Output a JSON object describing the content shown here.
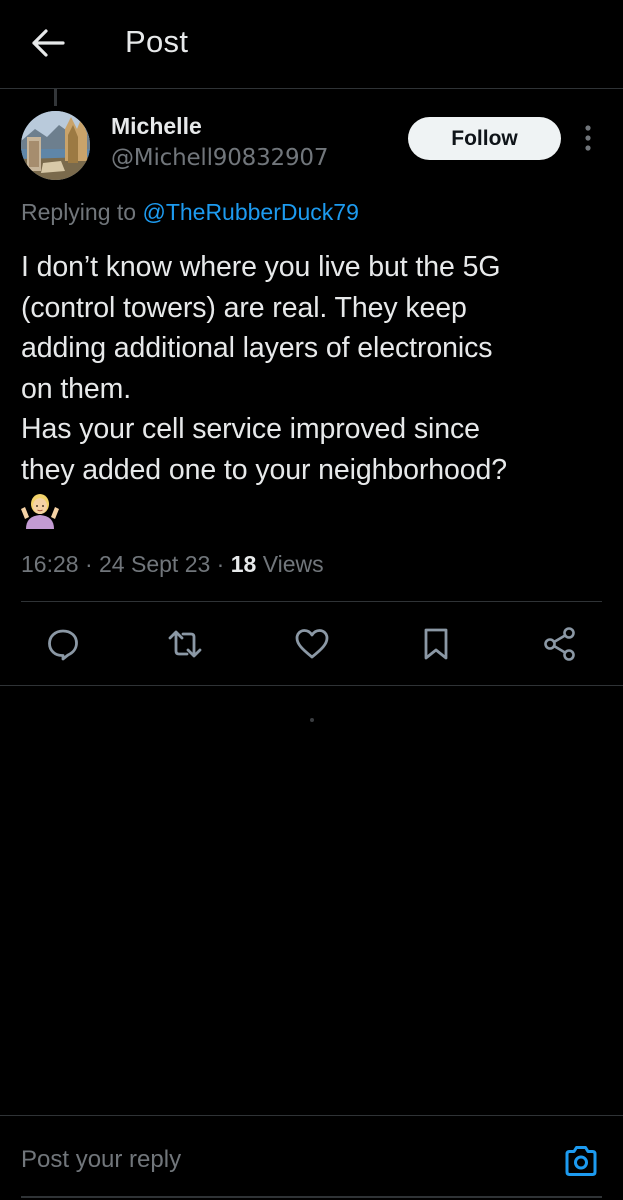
{
  "header": {
    "title": "Post",
    "back_icon": "arrow-left-icon"
  },
  "post": {
    "author": {
      "name": "Michelle",
      "handle": "@Michell90832907",
      "avatar_icon": "landscape-avatar"
    },
    "follow_label": "Follow",
    "more_icon": "more-vertical-icon",
    "replying_prefix": "Replying to ",
    "replying_to": "@TheRubberDuck79",
    "text": "I don’t know where you live but the 5G\n(control towers) are real. They keep\nadding additional layers of electronics\non them.\nHas your cell service improved since\nthey added one to your neighborhood?",
    "emoji_icon": "person-shrugging-emoji",
    "time": "16:28",
    "date": "24 Sept 23",
    "separator": " · ",
    "views_count": "18",
    "views_label": " Views"
  },
  "actions": [
    {
      "name": "reply",
      "icon": "comment-icon"
    },
    {
      "name": "repost",
      "icon": "repost-icon"
    },
    {
      "name": "like",
      "icon": "heart-icon"
    },
    {
      "name": "bookmark",
      "icon": "bookmark-icon"
    },
    {
      "name": "share",
      "icon": "share-icon"
    }
  ],
  "reply_bar": {
    "placeholder": "Post your reply",
    "camera_icon": "camera-icon"
  },
  "colors": {
    "background": "#000000",
    "text_primary": "#e7e9ea",
    "text_secondary": "#71767b",
    "link": "#1d9bf0",
    "divider": "#2f3336",
    "follow_bg": "#eff3f4"
  }
}
